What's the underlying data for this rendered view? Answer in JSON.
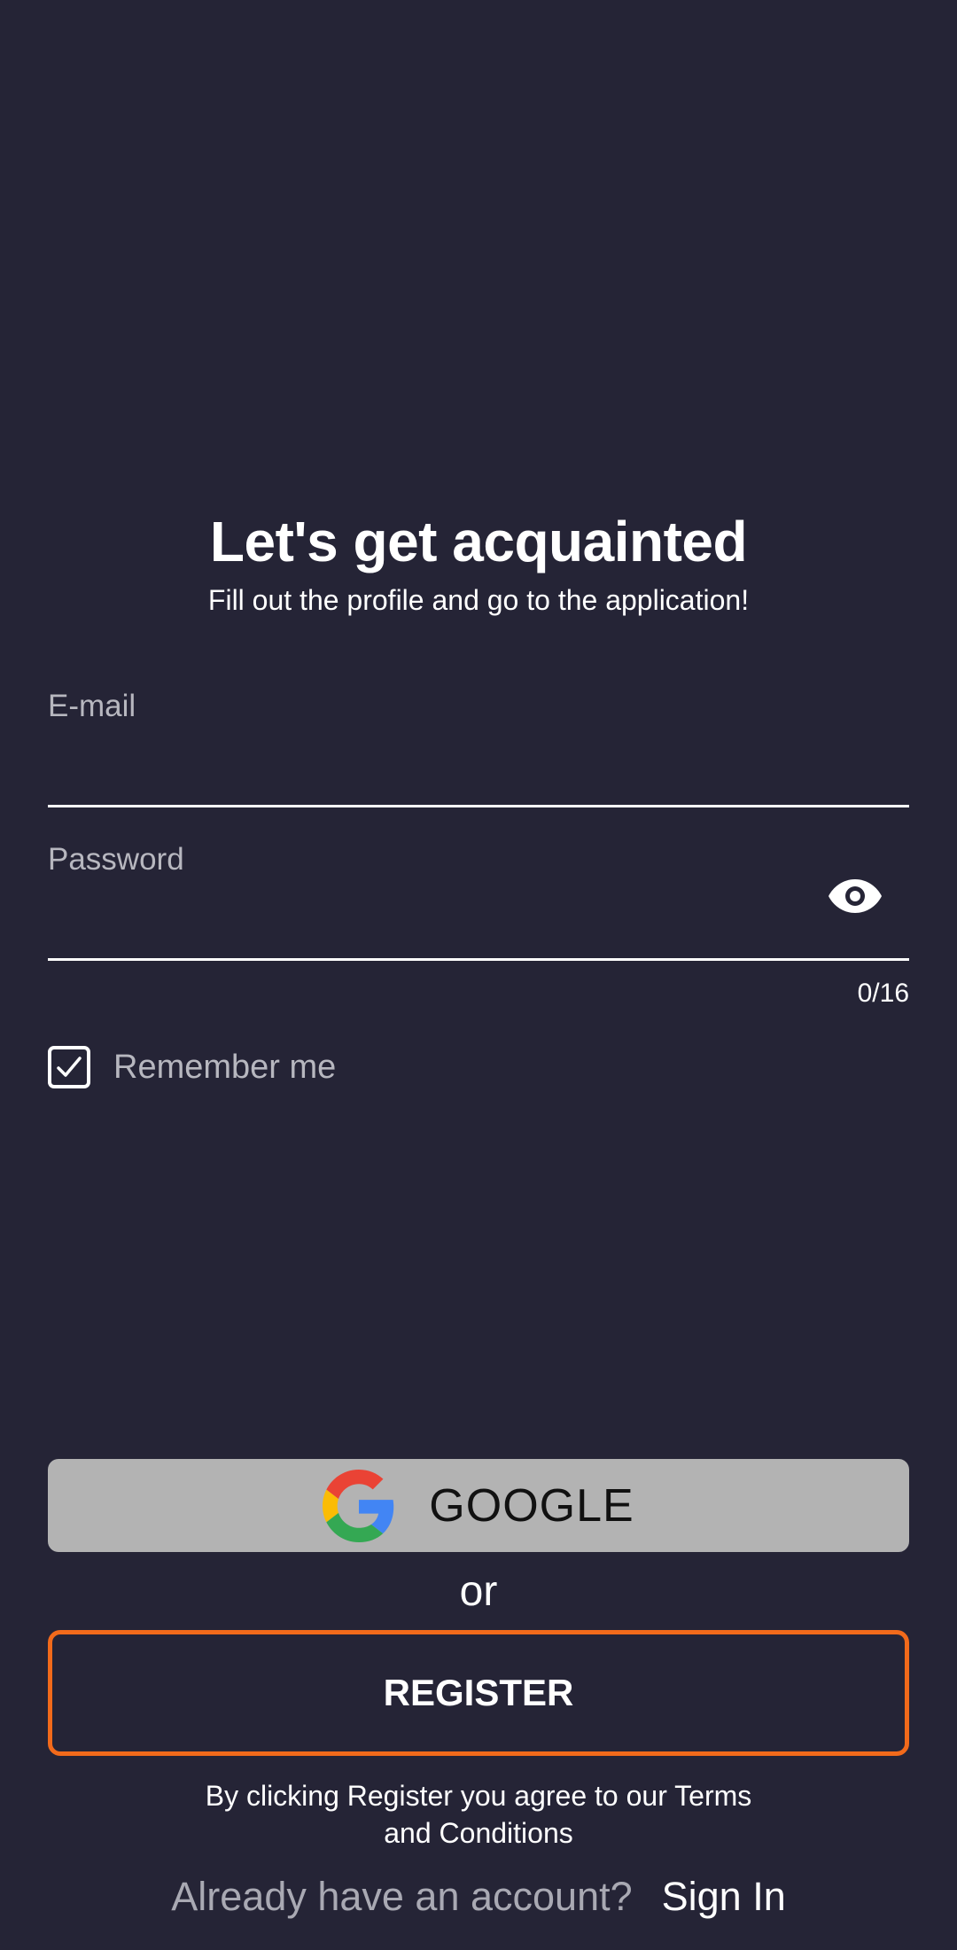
{
  "header": {
    "title": "Let's get acquainted",
    "subtitle": "Fill out the profile and go to the application!"
  },
  "form": {
    "email": {
      "label": "E-mail",
      "value": ""
    },
    "password": {
      "label": "Password",
      "value": "",
      "counter": "0/16",
      "toggle_icon": "eye-icon"
    },
    "remember": {
      "label": "Remember me",
      "checked": true,
      "icon": "check-icon"
    }
  },
  "actions": {
    "google_label": "GOOGLE",
    "google_icon": "google-logo-icon",
    "or_label": "or",
    "register_label": "REGISTER",
    "terms_line1": "By clicking Register you agree to our Terms",
    "terms_line2": "and Conditions",
    "signin_prompt": "Already have an account?",
    "signin_label": "Sign In"
  },
  "colors": {
    "background": "#252436",
    "accent": "#f26a1b",
    "google_button": "#b3b3b3",
    "muted_text": "#b7b7bf"
  }
}
